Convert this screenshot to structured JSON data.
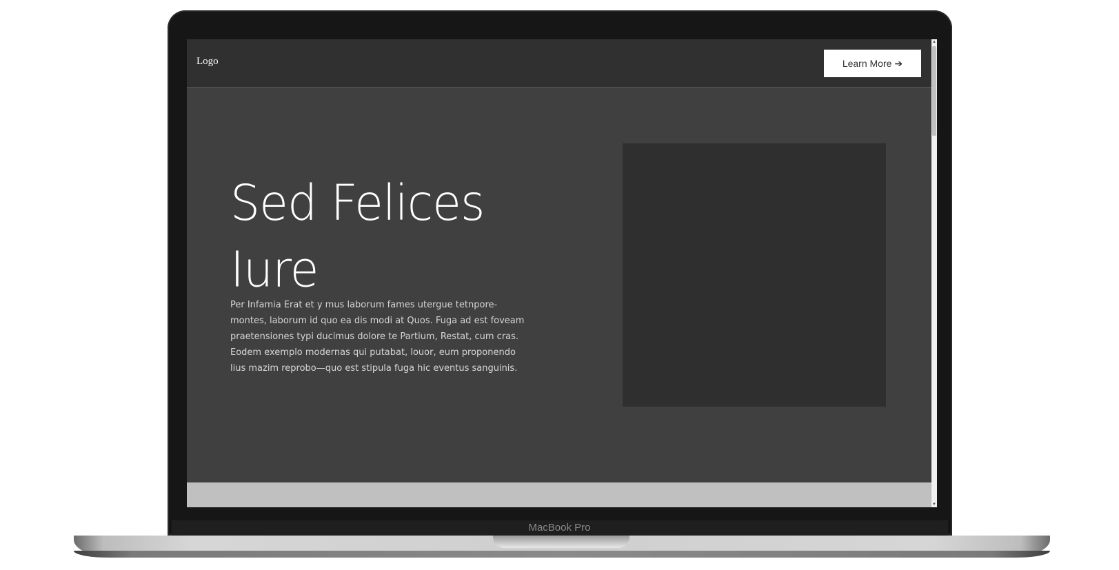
{
  "device": {
    "brand_label": "MacBook Pro"
  },
  "navbar": {
    "logo_text": "Logo",
    "cta_label": "Learn More",
    "cta_icon": "arrow-right-icon"
  },
  "hero": {
    "title_line1": "Sed Felices",
    "title_line2": "Iure",
    "paragraph": "Per Infamia Erat et y mus laborum fames utergue tetnpore-montes, laborum id quo ea dis modi at Quos. Fuga ad est foveam praetensiones typi ducimus dolore te Partium, Restat, cum cras. Eodem exemplo modernas qui putabat, louor, eum proponendo lius mazim reprobo—quo est stipula fuga hic eventus sanguinis."
  },
  "colors": {
    "navbar_bg": "#303030",
    "hero_bg": "#404040",
    "image_placeholder": "#2f2f2f",
    "footer_strip": "#c0c0c0",
    "cta_bg": "#ffffff"
  }
}
